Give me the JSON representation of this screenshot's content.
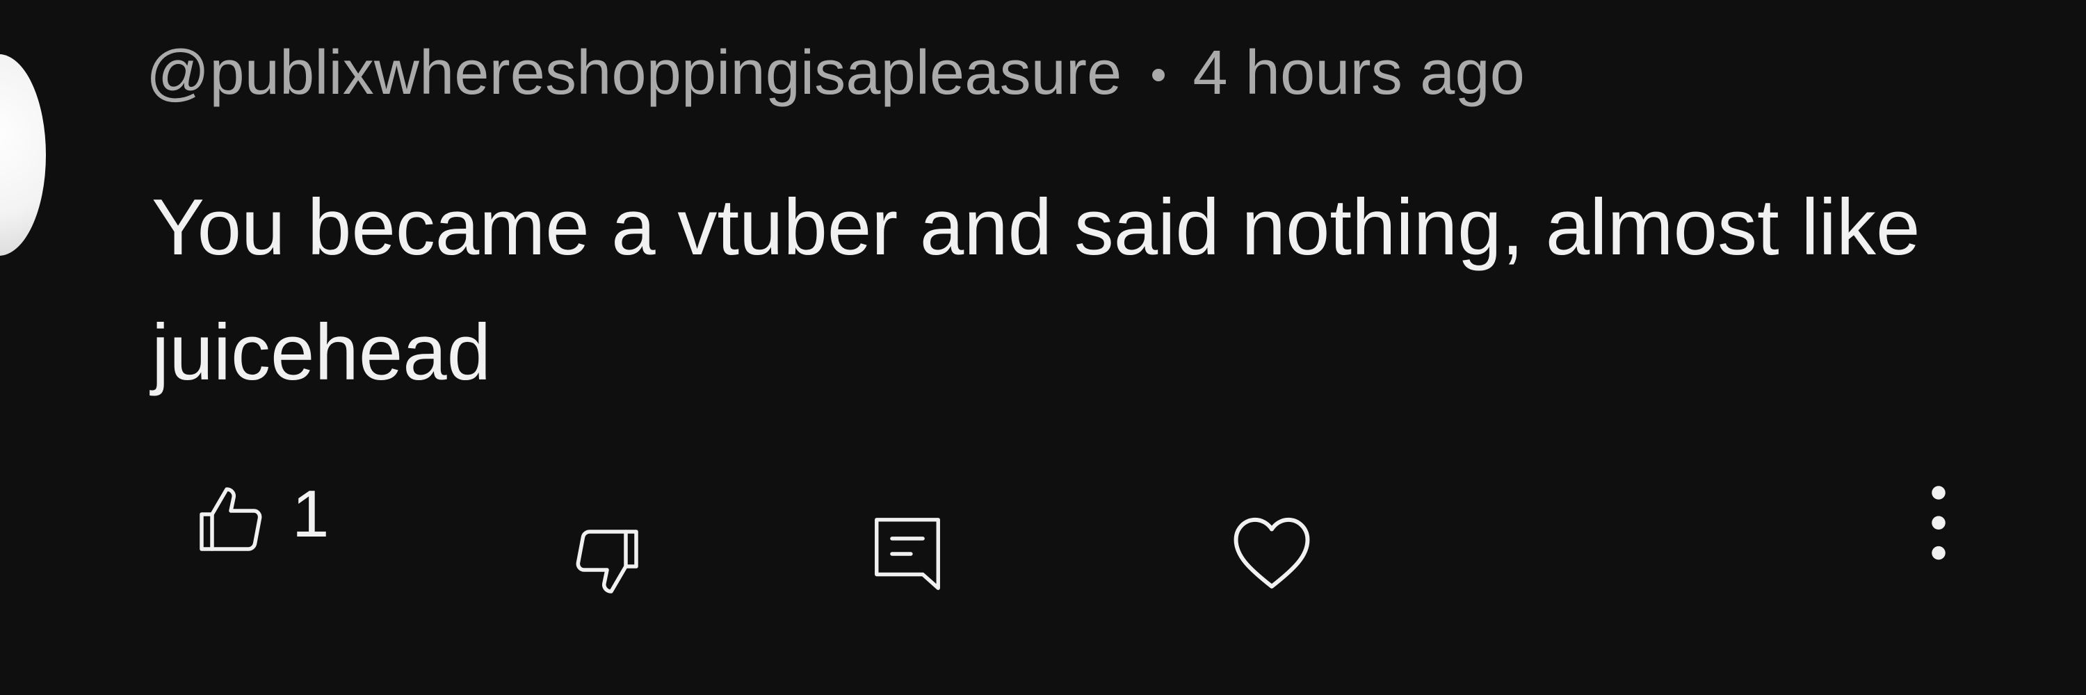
{
  "comment": {
    "author": "@publixwhereshoppingisapleasure",
    "timestamp": "4 hours ago",
    "text": "You became a vtuber and said nothing, almost like juicehead"
  },
  "actions": {
    "like_count": "1",
    "like_icon": "thumbs-up-icon",
    "dislike_icon": "thumbs-down-icon",
    "reply_icon": "reply-comment-icon",
    "heart_icon": "heart-icon",
    "more_icon": "more-vertical-icon"
  },
  "colors": {
    "background": "#0f0f0f",
    "meta_text": "#aaaaaa",
    "body_text": "#f1f1f1"
  }
}
